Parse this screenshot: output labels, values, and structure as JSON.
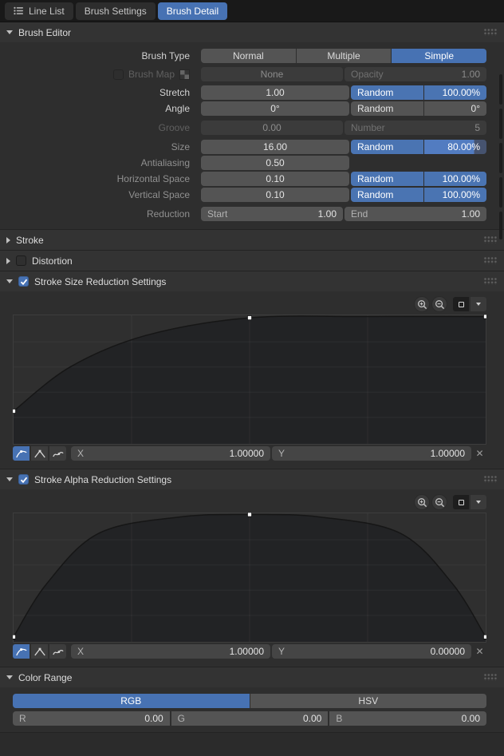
{
  "tabbar": {
    "tabs": [
      {
        "label": "Line List"
      },
      {
        "label": "Brush Settings"
      },
      {
        "label": "Brush Detail"
      }
    ],
    "active_tab": "Brush Detail"
  },
  "brush_editor": {
    "title": "Brush Editor",
    "brush_type": {
      "label": "Brush Type",
      "options": [
        "Normal",
        "Multiple",
        "Simple"
      ],
      "selected": "Simple"
    },
    "brush_map": {
      "label": "Brush Map",
      "checked": false,
      "menu_value": "None",
      "opacity_label": "Opacity",
      "opacity_value": "1.00"
    },
    "stretch": {
      "label": "Stretch",
      "value": "1.00",
      "random_label": "Random",
      "random_value": "100.00%",
      "random_on": true
    },
    "angle": {
      "label": "Angle",
      "value": "0°",
      "random_label": "Random",
      "random_value": "0°",
      "random_on": false
    },
    "groove": {
      "label": "Groove",
      "value": "0.00",
      "number_label": "Number",
      "number_value": "5"
    },
    "size": {
      "label": "Size",
      "value": "16.00",
      "random_label": "Random",
      "random_value": "80.00%",
      "random_on": true,
      "random_fill_pct": 80
    },
    "antialiasing": {
      "label": "Antialiasing",
      "value": "0.50"
    },
    "horizontal_space": {
      "label": "Horizontal Space",
      "value": "0.10",
      "random_label": "Random",
      "random_value": "100.00%",
      "random_on": true
    },
    "vertical_space": {
      "label": "Vertical Space",
      "value": "0.10",
      "random_label": "Random",
      "random_value": "100.00%",
      "random_on": true
    },
    "reduction": {
      "label": "Reduction",
      "start_label": "Start",
      "start_value": "1.00",
      "end_label": "End",
      "end_value": "1.00"
    }
  },
  "stroke": {
    "title": "Stroke",
    "expanded": false
  },
  "distortion": {
    "title": "Distortion",
    "expanded": false,
    "checked": false
  },
  "size_reduction": {
    "title": "Stroke Size Reduction Settings",
    "checked": true,
    "x_label": "X",
    "x_value": "1.00000",
    "y_label": "Y",
    "y_value": "1.00000",
    "curve_points": [
      [
        0,
        0.25
      ],
      [
        0.12,
        0.6
      ],
      [
        0.28,
        0.85
      ],
      [
        0.5,
        0.99
      ],
      [
        0.75,
        1
      ],
      [
        1,
        1
      ]
    ],
    "handles": [
      [
        0,
        0.25
      ],
      [
        0.5,
        0.99
      ],
      [
        1,
        1
      ]
    ]
  },
  "alpha_reduction": {
    "title": "Stroke Alpha Reduction Settings",
    "checked": true,
    "x_label": "X",
    "x_value": "1.00000",
    "y_label": "Y",
    "y_value": "0.00000",
    "curve_points": [
      [
        0,
        0.03
      ],
      [
        0.07,
        0.45
      ],
      [
        0.18,
        0.85
      ],
      [
        0.35,
        0.98
      ],
      [
        0.5,
        1
      ],
      [
        0.65,
        0.98
      ],
      [
        0.82,
        0.85
      ],
      [
        0.93,
        0.45
      ],
      [
        1,
        0.03
      ]
    ],
    "handles": [
      [
        0,
        0.03
      ],
      [
        0.5,
        1
      ],
      [
        1,
        0.03
      ]
    ]
  },
  "color_range": {
    "title": "Color Range",
    "modes": [
      "RGB",
      "HSV"
    ],
    "selected": "RGB",
    "channels": [
      {
        "label": "R",
        "value": "0.00"
      },
      {
        "label": "G",
        "value": "0.00"
      },
      {
        "label": "B",
        "value": "0.00"
      }
    ]
  },
  "icons": {
    "delete_point": "✕"
  },
  "colors": {
    "accent": "#4772b3",
    "slider_fill": "#527cc1",
    "slider_empty": "#46536f"
  }
}
